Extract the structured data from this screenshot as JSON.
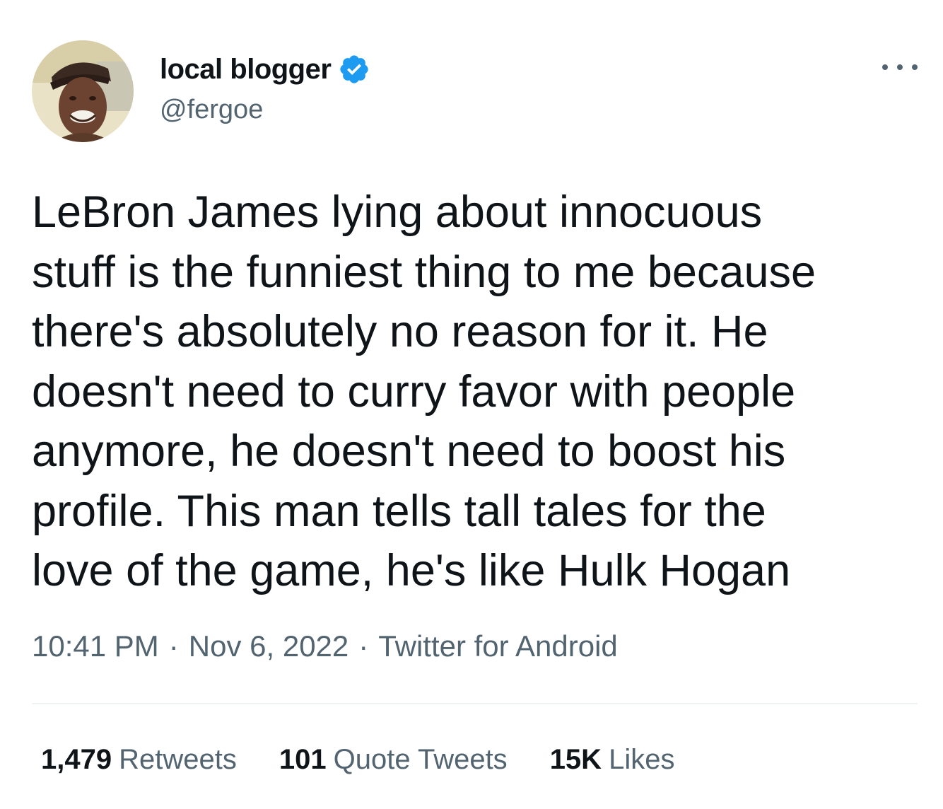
{
  "author": {
    "display_name": "local blogger",
    "handle": "@fergoe",
    "verified_icon": "verified-badge-icon",
    "avatar_icon": "user-avatar"
  },
  "tweet": {
    "text_lines": [
      "LeBron James lying about innocuous",
      "stuff is the funniest thing to me because",
      "there's absolutely no reason for it. He",
      "doesn't need to curry favor with people",
      "anymore, he doesn't need to boost his",
      "profile. This man tells tall tales for the",
      "love of the game, he's like Hulk Hogan"
    ],
    "time": "10:41 PM",
    "separator": "·",
    "date": "Nov 6, 2022",
    "source": "Twitter for Android"
  },
  "stats": {
    "retweets": {
      "count": "1,479",
      "label": "Retweets"
    },
    "quote_tweets": {
      "count": "101",
      "label": "Quote Tweets"
    },
    "likes": {
      "count": "15K",
      "label": "Likes"
    }
  },
  "colors": {
    "text_primary": "#0f1419",
    "text_secondary": "#536471",
    "verified_blue": "#1d9bf0",
    "divider": "#eff3f4"
  }
}
